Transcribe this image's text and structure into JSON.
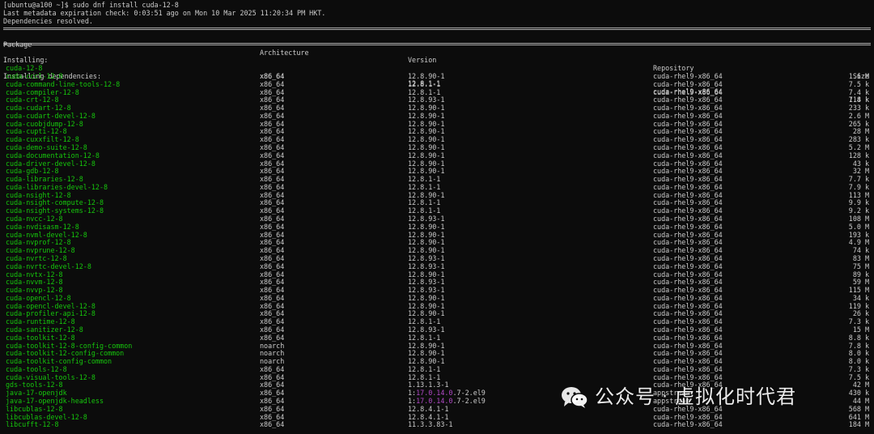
{
  "terminal": {
    "prompt_line": "[ubuntu@a100 ~]$ sudo dnf install cuda-12-8",
    "meta_line": "Last metadata expiration check: 0:03:51 ago on Mon 10 Mar 2025 11:20:34 PM HKT.",
    "deps_line": "Dependencies resolved.",
    "columns": {
      "package": "Package",
      "architecture": "Architecture",
      "version": "Version",
      "repository": "Repository",
      "size": "Size"
    },
    "installing_label": "Installing:",
    "installing_deps_label": "Installing dependencies:",
    "main_package": {
      "name": "cuda-12-8",
      "arch": "x86_64",
      "version": "12.8.1-1",
      "repo": "cuda-rhel9-x86_64",
      "size": "7.4 k"
    },
    "dependencies": [
      {
        "name": "cuda-cccl-12-8",
        "arch": "x86_64",
        "version": "12.8.90-1",
        "repo": "cuda-rhel9-x86_64",
        "size": "1.6 M"
      },
      {
        "name": "cuda-command-line-tools-12-8",
        "arch": "x86_64",
        "version": "12.8.1-1",
        "repo": "cuda-rhel9-x86_64",
        "size": "7.5 k"
      },
      {
        "name": "cuda-compiler-12-8",
        "arch": "x86_64",
        "version": "12.8.1-1",
        "repo": "cuda-rhel9-x86_64",
        "size": "7.4 k"
      },
      {
        "name": "cuda-crt-12-8",
        "arch": "x86_64",
        "version": "12.8.93-1",
        "repo": "cuda-rhel9-x86_64",
        "size": "118 k"
      },
      {
        "name": "cuda-cudart-12-8",
        "arch": "x86_64",
        "version": "12.8.90-1",
        "repo": "cuda-rhel9-x86_64",
        "size": "233 k"
      },
      {
        "name": "cuda-cudart-devel-12-8",
        "arch": "x86_64",
        "version": "12.8.90-1",
        "repo": "cuda-rhel9-x86_64",
        "size": "2.6 M"
      },
      {
        "name": "cuda-cuobjdump-12-8",
        "arch": "x86_64",
        "version": "12.8.90-1",
        "repo": "cuda-rhel9-x86_64",
        "size": "265 k"
      },
      {
        "name": "cuda-cupti-12-8",
        "arch": "x86_64",
        "version": "12.8.90-1",
        "repo": "cuda-rhel9-x86_64",
        "size": "28 M"
      },
      {
        "name": "cuda-cuxxfilt-12-8",
        "arch": "x86_64",
        "version": "12.8.90-1",
        "repo": "cuda-rhel9-x86_64",
        "size": "283 k"
      },
      {
        "name": "cuda-demo-suite-12-8",
        "arch": "x86_64",
        "version": "12.8.90-1",
        "repo": "cuda-rhel9-x86_64",
        "size": "5.2 M"
      },
      {
        "name": "cuda-documentation-12-8",
        "arch": "x86_64",
        "version": "12.8.90-1",
        "repo": "cuda-rhel9-x86_64",
        "size": "128 k"
      },
      {
        "name": "cuda-driver-devel-12-8",
        "arch": "x86_64",
        "version": "12.8.90-1",
        "repo": "cuda-rhel9-x86_64",
        "size": "43 k"
      },
      {
        "name": "cuda-gdb-12-8",
        "arch": "x86_64",
        "version": "12.8.90-1",
        "repo": "cuda-rhel9-x86_64",
        "size": "32 M"
      },
      {
        "name": "cuda-libraries-12-8",
        "arch": "x86_64",
        "version": "12.8.1-1",
        "repo": "cuda-rhel9-x86_64",
        "size": "7.7 k"
      },
      {
        "name": "cuda-libraries-devel-12-8",
        "arch": "x86_64",
        "version": "12.8.1-1",
        "repo": "cuda-rhel9-x86_64",
        "size": "7.9 k"
      },
      {
        "name": "cuda-nsight-12-8",
        "arch": "x86_64",
        "version": "12.8.90-1",
        "repo": "cuda-rhel9-x86_64",
        "size": "113 M"
      },
      {
        "name": "cuda-nsight-compute-12-8",
        "arch": "x86_64",
        "version": "12.8.1-1",
        "repo": "cuda-rhel9-x86_64",
        "size": "9.9 k"
      },
      {
        "name": "cuda-nsight-systems-12-8",
        "arch": "x86_64",
        "version": "12.8.1-1",
        "repo": "cuda-rhel9-x86_64",
        "size": "9.2 k"
      },
      {
        "name": "cuda-nvcc-12-8",
        "arch": "x86_64",
        "version": "12.8.93-1",
        "repo": "cuda-rhel9-x86_64",
        "size": "108 M"
      },
      {
        "name": "cuda-nvdisasm-12-8",
        "arch": "x86_64",
        "version": "12.8.90-1",
        "repo": "cuda-rhel9-x86_64",
        "size": "5.0 M"
      },
      {
        "name": "cuda-nvml-devel-12-8",
        "arch": "x86_64",
        "version": "12.8.90-1",
        "repo": "cuda-rhel9-x86_64",
        "size": "193 k"
      },
      {
        "name": "cuda-nvprof-12-8",
        "arch": "x86_64",
        "version": "12.8.90-1",
        "repo": "cuda-rhel9-x86_64",
        "size": "4.9 M"
      },
      {
        "name": "cuda-nvprune-12-8",
        "arch": "x86_64",
        "version": "12.8.90-1",
        "repo": "cuda-rhel9-x86_64",
        "size": "74 k"
      },
      {
        "name": "cuda-nvrtc-12-8",
        "arch": "x86_64",
        "version": "12.8.93-1",
        "repo": "cuda-rhel9-x86_64",
        "size": "83 M"
      },
      {
        "name": "cuda-nvrtc-devel-12-8",
        "arch": "x86_64",
        "version": "12.8.93-1",
        "repo": "cuda-rhel9-x86_64",
        "size": "75 M"
      },
      {
        "name": "cuda-nvtx-12-8",
        "arch": "x86_64",
        "version": "12.8.90-1",
        "repo": "cuda-rhel9-x86_64",
        "size": "89 k"
      },
      {
        "name": "cuda-nvvm-12-8",
        "arch": "x86_64",
        "version": "12.8.93-1",
        "repo": "cuda-rhel9-x86_64",
        "size": "59 M"
      },
      {
        "name": "cuda-nvvp-12-8",
        "arch": "x86_64",
        "version": "12.8.93-1",
        "repo": "cuda-rhel9-x86_64",
        "size": "115 M"
      },
      {
        "name": "cuda-opencl-12-8",
        "arch": "x86_64",
        "version": "12.8.90-1",
        "repo": "cuda-rhel9-x86_64",
        "size": "34 k"
      },
      {
        "name": "cuda-opencl-devel-12-8",
        "arch": "x86_64",
        "version": "12.8.90-1",
        "repo": "cuda-rhel9-x86_64",
        "size": "119 k"
      },
      {
        "name": "cuda-profiler-api-12-8",
        "arch": "x86_64",
        "version": "12.8.90-1",
        "repo": "cuda-rhel9-x86_64",
        "size": "26 k"
      },
      {
        "name": "cuda-runtime-12-8",
        "arch": "x86_64",
        "version": "12.8.1-1",
        "repo": "cuda-rhel9-x86_64",
        "size": "7.3 k"
      },
      {
        "name": "cuda-sanitizer-12-8",
        "arch": "x86_64",
        "version": "12.8.93-1",
        "repo": "cuda-rhel9-x86_64",
        "size": "15 M"
      },
      {
        "name": "cuda-toolkit-12-8",
        "arch": "x86_64",
        "version": "12.8.1-1",
        "repo": "cuda-rhel9-x86_64",
        "size": "8.8 k"
      },
      {
        "name": "cuda-toolkit-12-8-config-common",
        "arch": "noarch",
        "version": "12.8.90-1",
        "repo": "cuda-rhel9-x86_64",
        "size": "7.8 k"
      },
      {
        "name": "cuda-toolkit-12-config-common",
        "arch": "noarch",
        "version": "12.8.90-1",
        "repo": "cuda-rhel9-x86_64",
        "size": "8.0 k"
      },
      {
        "name": "cuda-toolkit-config-common",
        "arch": "noarch",
        "version": "12.8.90-1",
        "repo": "cuda-rhel9-x86_64",
        "size": "8.0 k"
      },
      {
        "name": "cuda-tools-12-8",
        "arch": "x86_64",
        "version": "12.8.1-1",
        "repo": "cuda-rhel9-x86_64",
        "size": "7.3 k"
      },
      {
        "name": "cuda-visual-tools-12-8",
        "arch": "x86_64",
        "version": "12.8.1-1",
        "repo": "cuda-rhel9-x86_64",
        "size": "7.5 k"
      },
      {
        "name": "gds-tools-12-8",
        "arch": "x86_64",
        "version": "1.13.1.3-1",
        "repo": "cuda-rhel9-x86_64",
        "size": "42 M"
      },
      {
        "name": "java-17-openjdk",
        "arch": "x86_64",
        "version_pre": "1:",
        "version_hl": "17.0.14.0",
        "version_post": ".7-2.el9",
        "repo": "appstream",
        "size": "430 k"
      },
      {
        "name": "java-17-openjdk-headless",
        "arch": "x86_64",
        "version_pre": "1:",
        "version_hl": "17.0.14.0",
        "version_post": ".7-2.el9",
        "repo": "appstream",
        "size": "44 M"
      },
      {
        "name": "libcublas-12-8",
        "arch": "x86_64",
        "version": "12.8.4.1-1",
        "repo": "cuda-rhel9-x86_64",
        "size": "568 M"
      },
      {
        "name": "libcublas-devel-12-8",
        "arch": "x86_64",
        "version": "12.8.4.1-1",
        "repo": "cuda-rhel9-x86_64",
        "size": "641 M"
      },
      {
        "name": "libcufft-12-8",
        "arch": "x86_64",
        "version": "11.3.3.83-1",
        "repo": "cuda-rhel9-x86_64",
        "size": "184 M"
      }
    ],
    "colors": {
      "background": "#0c0c0c",
      "text": "#cccccc",
      "package_green": "#16c60c",
      "version_highlight": "#b148c6"
    }
  },
  "watermark": {
    "text_left": "公众号",
    "dot": "·",
    "text_right": "虚拟化时代君",
    "icon": "wechat-icon"
  }
}
